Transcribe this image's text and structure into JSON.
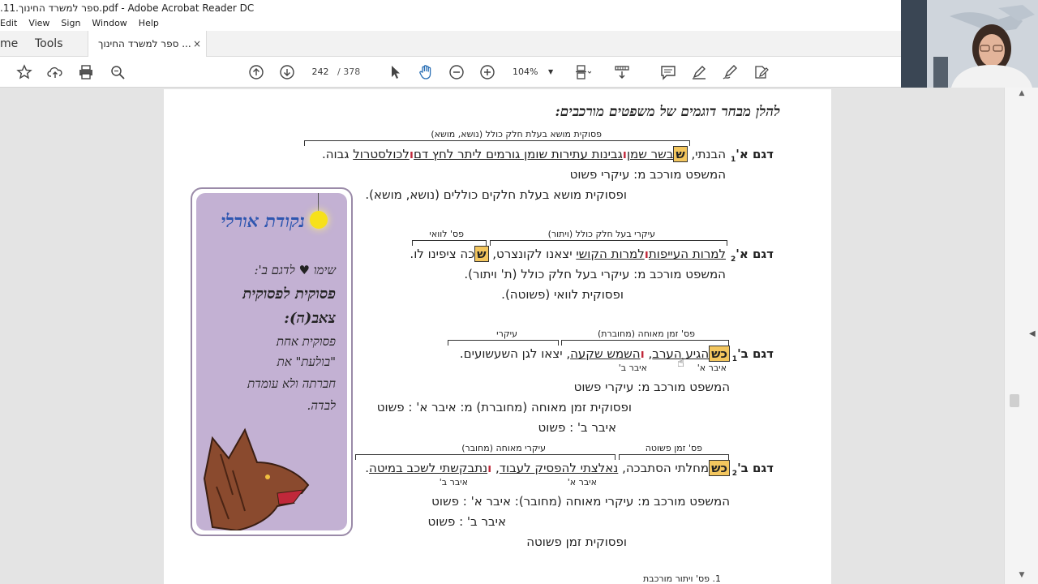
{
  "window": {
    "title": ".11.ספר למשרד החינוך.pdf - Adobe Acrobat Reader DC"
  },
  "menu": [
    "Edit",
    "View",
    "Sign",
    "Window",
    "Help"
  ],
  "tabs": {
    "home": "me",
    "tools": "Tools",
    "document": "ספר למשרד החינוך ...",
    "close": "×"
  },
  "toolbar": {
    "page_current": "242",
    "page_total": "/ 378",
    "zoom": "104%"
  },
  "page": {
    "heading": "להלן מבחר דוגמים של משפטים מורכבים:",
    "a1": {
      "label": "דגם א'",
      "sub": "1",
      "bracket_label": "פסוקית מושא בעלת חלק כולל (נושא, מושא)",
      "intro": "הבנתי, ",
      "marker": "ש",
      "p1": "בשר שמן",
      "p2": "גבינות עתירות שומן גורמים ליתר לחץ דם",
      "p3": "לכולסטרול",
      "tail": " גבוה.",
      "line2": "המשפט מורכב מ: עיקרי פשוט",
      "line3": "ופסוקית מושא בעלת חלקים כוללים (נושא, מושא)."
    },
    "a2": {
      "label": "דגם א'",
      "sub": "2",
      "bracket1": "עיקרי בעל חלק כולל (ויתור)",
      "bracket2": "פס' לוואי",
      "p1": "למרות העייפות",
      "p2": "למרות הקושי",
      "mid": " יצאנו לקונצרט, ",
      "marker": "ש",
      "tail": "כה ציפינו לו.",
      "line2": "המשפט מורכב מ:  עיקרי בעל חלק כולל (ת' ויתור).",
      "line3": "ופסוקית לוואי (פשוטה)."
    },
    "b1": {
      "label": "דגם ב'",
      "sub": "1",
      "bracket1": "פס' זמן מאוחה (מחוברת)",
      "bracket2": "עיקרי",
      "marker": "כש",
      "p1": "הגיע הערב",
      "p2": "השמש שקעה",
      "tail": ", יצאו לגן השעשועים.",
      "under1": "איבר א'",
      "under2": "איבר ב'",
      "line2": "המשפט מורכב מ:  עיקרי פשוט",
      "line3": "ופסוקית זמן מאוחה (מחוברת) מ: איבר א' : פשוט",
      "line4": "איבר ב' : פשוט"
    },
    "b2": {
      "label": "דגם ב'",
      "sub": "2",
      "bracket1": "פס' זמן פשוטה",
      "bracket2": "עיקרי מאוחה (מחובר)",
      "marker": "כש",
      "p0": "מחלתי הסתבכה, ",
      "p1": "נאלצתי להפסיק לעבוד",
      "p2": "נתבקשתי לשכב במיטה",
      "tail": ".",
      "under1": "איבר א'",
      "under2": "איבר ב'",
      "line2": "המשפט מורכב מ:  עיקרי מאוחה (מחובר): איבר א' : פשוט",
      "line3": "איבר ב' : פשוט",
      "line4": "ופסוקית זמן פשוטה"
    },
    "footnote": "1. פס' ויתור מורכבת"
  },
  "sidecard": {
    "title": "נקודת אורלי",
    "l1": "שימו ♥ לדגם ב':",
    "l2": "פסוקית לפסוקית",
    "l3": "צאב(ה):",
    "l4": "פסוקית אחת",
    "l5": "\"בולעת\" את",
    "l6": "חברתה ולא עומדת",
    "l7": "לבדה."
  }
}
